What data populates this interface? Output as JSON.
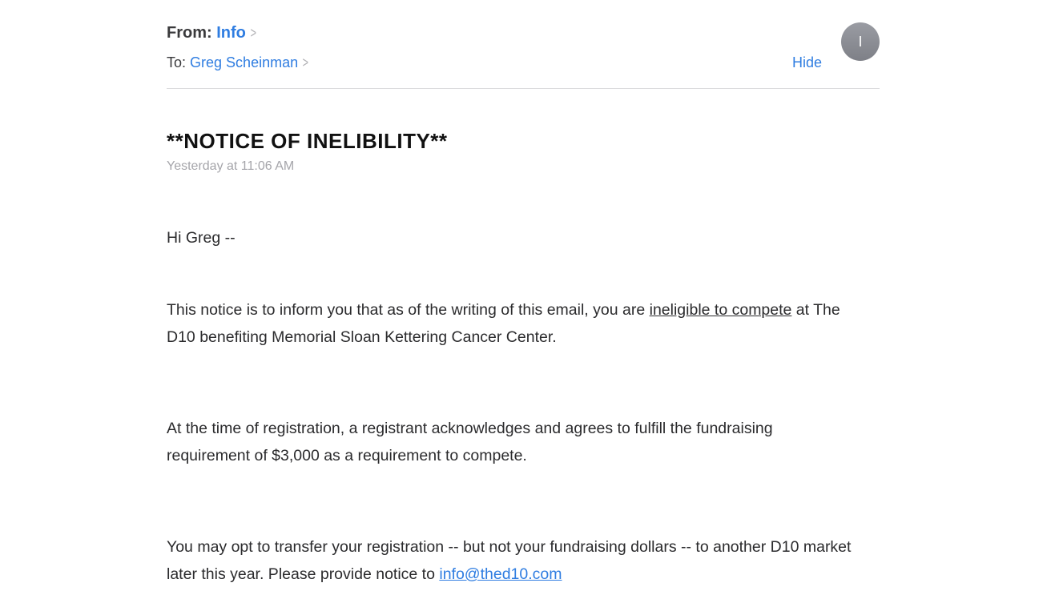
{
  "header": {
    "from_label": "From:",
    "from_name": "Info",
    "to_label": "To:",
    "to_name": "Greg Scheinman",
    "hide_label": "Hide",
    "avatar_initial": "I"
  },
  "message": {
    "subject": "**NOTICE OF INELIBILITY**",
    "timestamp": "Yesterday at 11:06 AM",
    "greeting": "Hi Greg --",
    "p1_before": "This notice is to inform you that as of the writing of this email, you are ",
    "p1_emphasis": "ineligible to compete",
    "p1_after": " at The D10 benefiting Memorial Sloan Kettering Cancer Center.",
    "p2": "At the time of registration, a registrant acknowledges and agrees to fulfill the fundraising requirement of $3,000 as a requirement to compete.",
    "p3_before": "You may opt to transfer your registration -- but not your fundraising dollars -- to another D10 market later this year.  Please provide notice to ",
    "p3_link": "info@thed10.com"
  },
  "colors": {
    "link": "#2f7de1",
    "avatar": "#8a8c93",
    "timestamp": "#a5a5aa"
  },
  "icons": {
    "chevron": "chevron-right-icon"
  }
}
